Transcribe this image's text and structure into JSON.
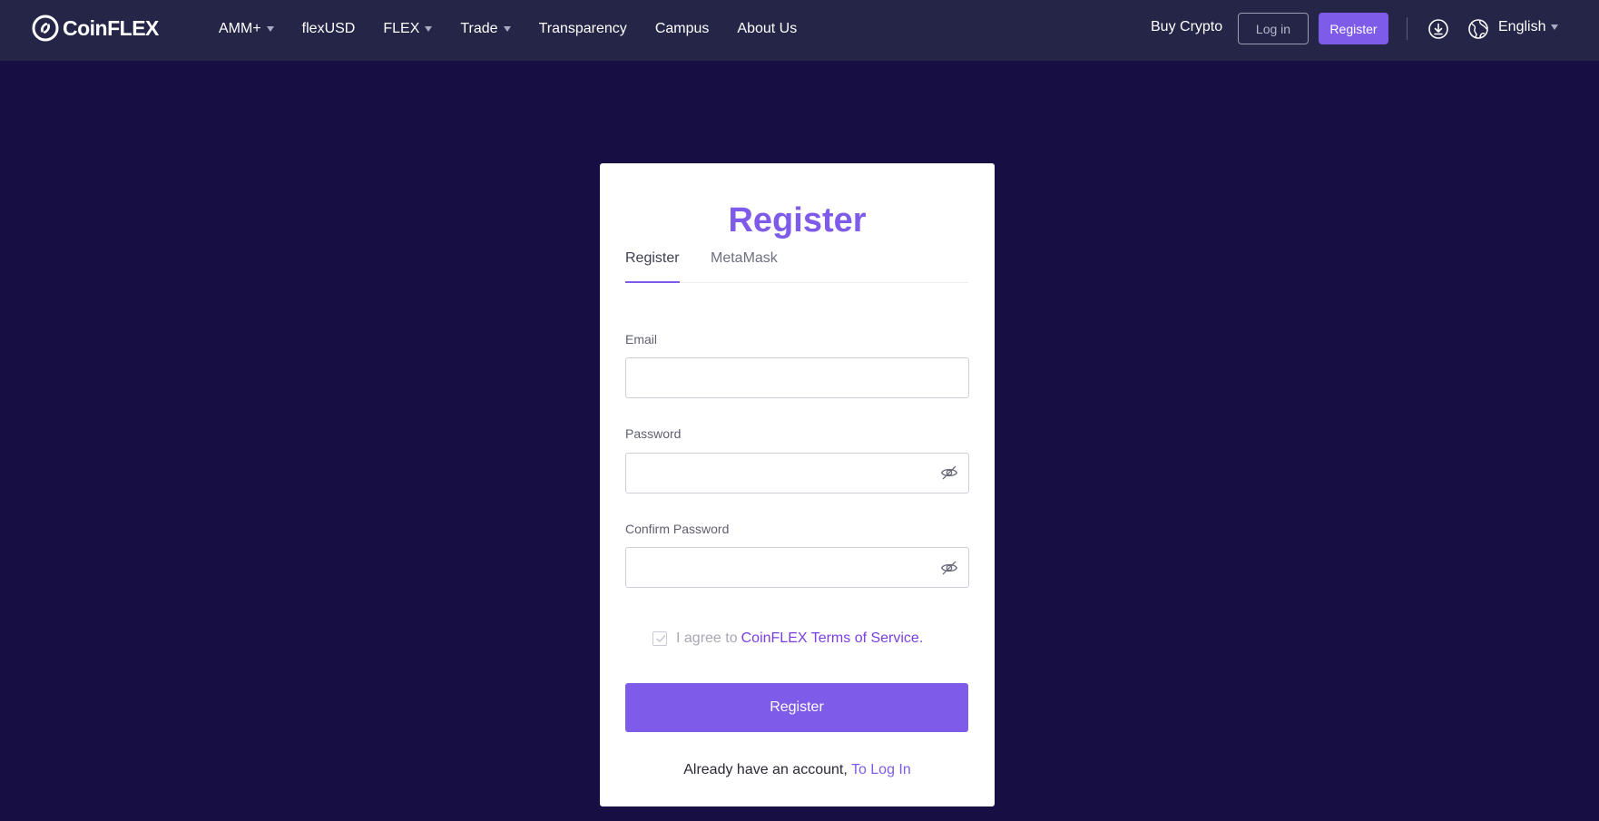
{
  "header": {
    "brand": "CoinFLEX",
    "nav": [
      {
        "label": "AMM+",
        "has_caret": true
      },
      {
        "label": "flexUSD",
        "has_caret": false
      },
      {
        "label": "FLEX",
        "has_caret": true
      },
      {
        "label": "Trade",
        "has_caret": true
      },
      {
        "label": "Transparency",
        "has_caret": false
      },
      {
        "label": "Campus",
        "has_caret": false
      },
      {
        "label": "About Us",
        "has_caret": false
      }
    ],
    "buy_crypto": "Buy Crypto",
    "login_label": "Log in",
    "register_label": "Register",
    "language": "English",
    "icons": {
      "download": "download-icon",
      "globe": "globe-icon",
      "caret": "caret-down-icon"
    }
  },
  "form": {
    "title": "Register",
    "tabs": [
      {
        "label": "Register",
        "active": true
      },
      {
        "label": "MetaMask",
        "active": false
      }
    ],
    "email": {
      "label": "Email",
      "value": "",
      "placeholder": ""
    },
    "password": {
      "label": "Password",
      "value": "",
      "placeholder": ""
    },
    "confirm_password": {
      "label": "Confirm Password",
      "value": "",
      "placeholder": ""
    },
    "agree_prefix": "I agree to",
    "terms_link": "CoinFLEX Terms of Service.",
    "submit_label": "Register",
    "have_account": "Already have an account,",
    "to_login": "To Log In"
  },
  "colors": {
    "page_bg": "#170e44",
    "header_bg": "#242547",
    "accent": "#7f5bea",
    "link": "#7b3fe0"
  }
}
